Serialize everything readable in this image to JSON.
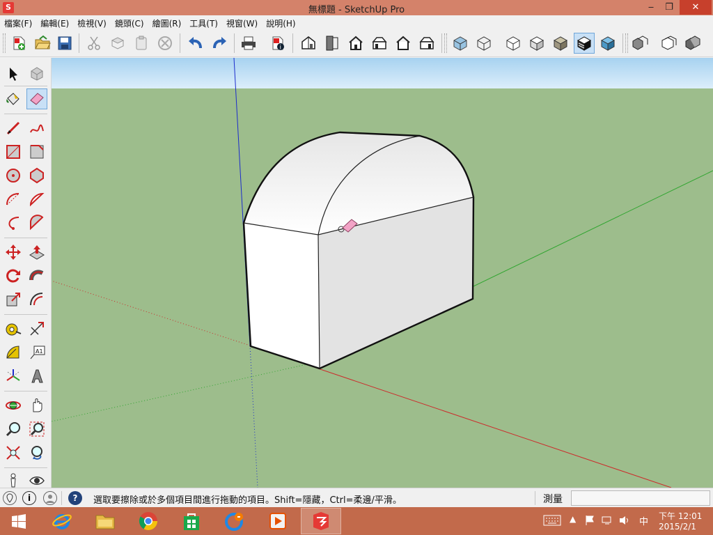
{
  "window": {
    "title": "無標題 - SketchUp Pro",
    "app_icon": "sketchup-icon",
    "controls": {
      "minimize": "‒",
      "maximize": "❐",
      "close": "✕"
    }
  },
  "menu": [
    "檔案(F)",
    "編輯(E)",
    "檢視(V)",
    "鏡頭(C)",
    "繪圖(R)",
    "工具(T)",
    "視窗(W)",
    "說明(H)"
  ],
  "toolbar_icons": [
    "new-file-icon",
    "open-file-icon",
    "save-icon",
    "cut-icon",
    "copy-icon",
    "paste-icon",
    "erase-selection-icon",
    "undo-icon",
    "redo-icon",
    "print-icon",
    "model-info-icon",
    "iso-view-icon",
    "top-view-icon",
    "front-view-icon",
    "right-view-icon",
    "back-view-icon",
    "left-view-icon",
    "xray-style-icon",
    "wireframe-style-icon",
    "hidden-line-style-icon",
    "shaded-style-icon",
    "shaded-texture-style-icon",
    "monochrome-style-icon",
    "component-icon",
    "group-icon",
    "section-icon"
  ],
  "left_tools": [
    "select-icon",
    "make-component-icon",
    "paint-bucket-icon",
    "eraser-icon",
    "line-icon",
    "freehand-icon",
    "rectangle-icon",
    "rotated-rectangle-icon",
    "circle-icon",
    "polygon-icon",
    "arc-icon",
    "pie-icon",
    "three-point-arc-icon",
    "two-point-arc-icon",
    "move-icon",
    "push-pull-icon",
    "rotate-icon",
    "follow-me-icon",
    "scale-icon",
    "offset-icon",
    "tape-measure-icon",
    "dimension-icon",
    "protractor-icon",
    "text-icon",
    "axes-icon",
    "3d-text-icon",
    "orbit-icon",
    "pan-icon",
    "zoom-icon",
    "zoom-window-icon",
    "zoom-extents-icon",
    "previous-view-icon",
    "position-camera-icon",
    "look-around-icon"
  ],
  "selected_tool": "eraser-icon",
  "colors": {
    "sky": "#a8d3f0",
    "ground": "#9dbd8c",
    "axis_red": "#cc2b2b",
    "axis_green": "#2fa52f",
    "axis_blue": "#1b2bcc",
    "titlebar": "#d4826a",
    "taskbar": "#c26a4b"
  },
  "status": {
    "text": "選取要擦除或於多個項目間進行拖動的項目。Shift=隱藏，Ctrl=柔邊/平滑。",
    "measure_label": "測量",
    "measure_value": ""
  },
  "taskbar": {
    "apps": [
      "ie-icon",
      "file-explorer-icon",
      "chrome-icon",
      "store-icon",
      "network-app-icon",
      "media-player-icon",
      "sketchup-task-icon"
    ],
    "active_app": "sketchup-task-icon",
    "input_method": "中",
    "time": "下午 12:01",
    "date": "2015/2/1"
  }
}
